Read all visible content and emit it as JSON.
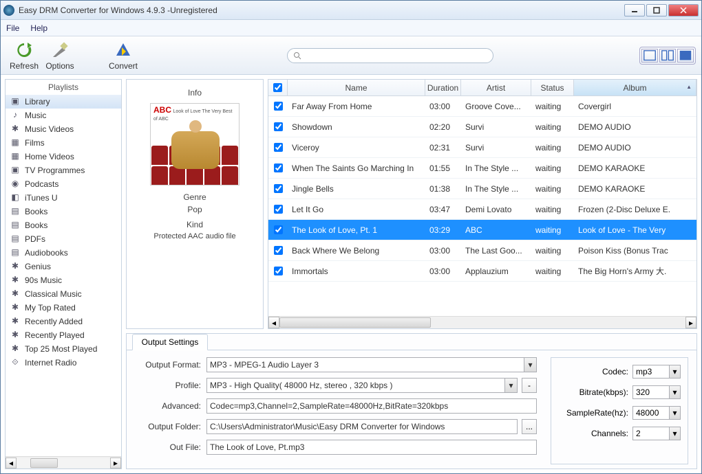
{
  "title": "Easy DRM Converter for Windows 4.9.3 -Unregistered",
  "menu": {
    "file": "File",
    "help": "Help"
  },
  "toolbar": {
    "refresh": "Refresh",
    "options": "Options",
    "convert": "Convert"
  },
  "sidebar": {
    "heading": "Playlists",
    "items": [
      {
        "label": "Library"
      },
      {
        "label": "Music"
      },
      {
        "label": "Music Videos"
      },
      {
        "label": "Films"
      },
      {
        "label": "Home Videos"
      },
      {
        "label": "TV Programmes"
      },
      {
        "label": "Podcasts"
      },
      {
        "label": "iTunes U"
      },
      {
        "label": "Books"
      },
      {
        "label": "Books"
      },
      {
        "label": "PDFs"
      },
      {
        "label": "Audiobooks"
      },
      {
        "label": "Genius"
      },
      {
        "label": "90s Music"
      },
      {
        "label": "Classical Music"
      },
      {
        "label": "My Top Rated"
      },
      {
        "label": "Recently Added"
      },
      {
        "label": "Recently Played"
      },
      {
        "label": "Top 25 Most Played"
      },
      {
        "label": "Internet Radio"
      }
    ]
  },
  "info": {
    "heading": "Info",
    "cover_title": "ABC",
    "cover_sub": "Look of Love\nThe Very Best of ABC",
    "genre_label": "Genre",
    "genre": "Pop",
    "kind_label": "Kind",
    "kind": "Protected AAC audio file"
  },
  "grid": {
    "cols": {
      "name": "Name",
      "duration": "Duration",
      "artist": "Artist",
      "status": "Status",
      "album": "Album"
    },
    "rows": [
      {
        "name": "Far Away From Home",
        "dur": "03:00",
        "art": "Groove Cove...",
        "stat": "waiting",
        "alb": "Covergirl"
      },
      {
        "name": "Showdown",
        "dur": "02:20",
        "art": "Survi",
        "stat": "waiting",
        "alb": "DEMO AUDIO"
      },
      {
        "name": "Viceroy",
        "dur": "02:31",
        "art": "Survi",
        "stat": "waiting",
        "alb": "DEMO AUDIO"
      },
      {
        "name": "When The Saints Go Marching In",
        "dur": "01:55",
        "art": "In The Style ...",
        "stat": "waiting",
        "alb": "DEMO KARAOKE"
      },
      {
        "name": "Jingle Bells",
        "dur": "01:38",
        "art": "In The Style ...",
        "stat": "waiting",
        "alb": "DEMO KARAOKE"
      },
      {
        "name": "Let It Go",
        "dur": "03:47",
        "art": "Demi Lovato",
        "stat": "waiting",
        "alb": "Frozen (2-Disc Deluxe E."
      },
      {
        "name": "The Look of Love, Pt. 1",
        "dur": "03:29",
        "art": "ABC",
        "stat": "waiting",
        "alb": "Look of Love - The Very"
      },
      {
        "name": "Back Where We Belong",
        "dur": "03:00",
        "art": "The Last Goo...",
        "stat": "waiting",
        "alb": "Poison Kiss (Bonus Trac"
      },
      {
        "name": "Immortals",
        "dur": "03:00",
        "art": "Applauzium",
        "stat": "waiting",
        "alb": "The Big Horn's Army 大."
      }
    ],
    "selected_index": 6
  },
  "output": {
    "tab": "Output Settings",
    "format_label": "Output Format:",
    "format": "MP3 - MPEG-1 Audio Layer 3",
    "profile_label": "Profile:",
    "profile": "MP3 - High Quality( 48000 Hz, stereo , 320 kbps  )",
    "advanced_label": "Advanced:",
    "advanced": "Codec=mp3,Channel=2,SampleRate=48000Hz,BitRate=320kbps",
    "folder_label": "Output Folder:",
    "folder": "C:\\Users\\Administrator\\Music\\Easy DRM Converter for Windows",
    "outfile_label": "Out File:",
    "outfile": "The Look of Love, Pt.mp3",
    "browse": "...",
    "profiledlg": "-"
  },
  "right": {
    "codec_label": "Codec:",
    "codec": "mp3",
    "bitrate_label": "Bitrate(kbps):",
    "bitrate": "320",
    "samplerate_label": "SampleRate(hz):",
    "samplerate": "48000",
    "channels_label": "Channels:",
    "channels": "2"
  }
}
